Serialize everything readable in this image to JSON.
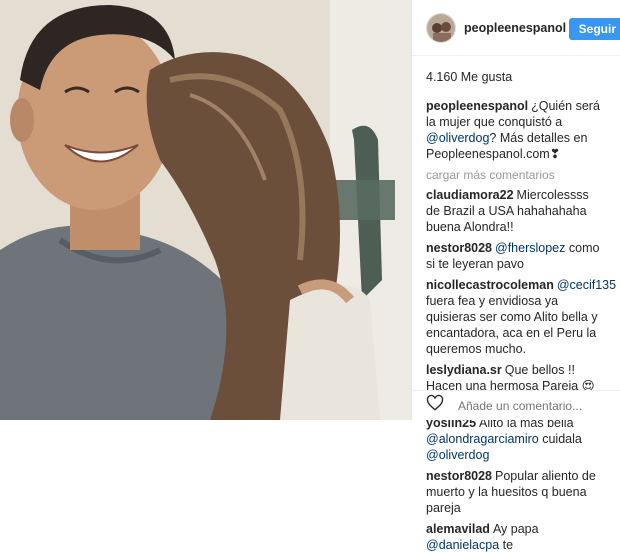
{
  "post": {
    "username": "peopleenespanol",
    "follow_label": "Seguir",
    "likes": "4.160 Me gusta",
    "caption": {
      "user": "peopleenespanol",
      "text_before": "¿Quién será la mujer que conquistó a ",
      "mention": "@oliverdog",
      "text_after": "? Más detalles en Peopleenespanol.com❣"
    },
    "load_more": "cargar más comentarios",
    "comments": [
      {
        "user": "claudiamora22",
        "pre": "Miercolessss de Brazil a USA hahahahaha buena Alondra!!",
        "mention": "",
        "post": ""
      },
      {
        "user": "nestor8028",
        "pre": "",
        "mention": "@fherslopez",
        "post": " como si te leyeran pavo"
      },
      {
        "user": "nicollecastrocoleman",
        "pre": "",
        "mention": "@cecif135",
        "post": " fuera fea y envidiosa ya quisieras ser como Alito bella y encantadora, aca en el Peru la queremos mucho."
      },
      {
        "user": "leslydiana.sr",
        "pre": "Que bellos !! Hacen una hermosa Pareja 😍😍😍😍",
        "mention": "",
        "post": ""
      },
      {
        "user": "yoslin25",
        "pre": "Alito la mas bella ",
        "mention": "@alondragarciamiro",
        "post": " cuidala ",
        "mention2": "@oliverdog"
      },
      {
        "user": "nestor8028",
        "pre": "Popular aliento de muerto y la huesitos q buena pareja",
        "mention": "",
        "post": ""
      },
      {
        "user": "alemavilad",
        "pre": "Ay papa ",
        "mention": "@danielacpa",
        "post": " te"
      }
    ],
    "add_comment_placeholder": "Añade un comentario..."
  },
  "icons": {
    "like": "heart-icon",
    "avatar": "avatar"
  }
}
